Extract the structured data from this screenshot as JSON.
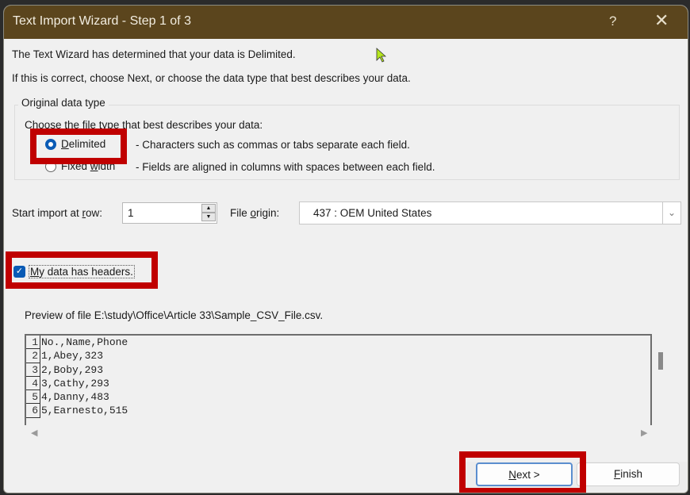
{
  "dialog": {
    "title": "Text Import Wizard - Step 1 of 3",
    "help_label": "?",
    "close_label": "✕"
  },
  "intro": {
    "line1": "The Text Wizard has determined that your data is Delimited.",
    "line2": "If this is correct, choose Next, or choose the data type that best describes your data."
  },
  "data_type": {
    "group_label": "Original data type",
    "prompt": "Choose the file type that best describes your data:",
    "options": [
      {
        "label_pre": "",
        "label_underline": "D",
        "label_post": "elimited",
        "description": "- Characters such as commas or tabs separate each field.",
        "selected": true
      },
      {
        "label_pre": "Fixed ",
        "label_underline": "w",
        "label_post": "idth",
        "description": "- Fields are aligned in columns with spaces between each field.",
        "selected": false
      }
    ]
  },
  "start_row": {
    "label_pre": "Start import at ",
    "label_underline": "r",
    "label_post": "ow:",
    "value": "1"
  },
  "file_origin": {
    "label_pre": "File ",
    "label_underline": "o",
    "label_post": "rigin:",
    "value": "437 : OEM United States",
    "chevron": "⌄"
  },
  "headers_checkbox": {
    "checked": true,
    "label_underline": "M",
    "label_post": "y data has headers."
  },
  "preview": {
    "label": "Preview of file E:\\study\\Office\\Article 33\\Sample_CSV_File.csv.",
    "rows": [
      {
        "num": "1",
        "text": "No.,Name,Phone"
      },
      {
        "num": "2",
        "text": "1,Abey,323"
      },
      {
        "num": "3",
        "text": "2,Boby,293"
      },
      {
        "num": "4",
        "text": "3,Cathy,293"
      },
      {
        "num": "5",
        "text": "4,Danny,483"
      },
      {
        "num": "6",
        "text": "5,Earnesto,515"
      }
    ]
  },
  "buttons": {
    "next_underline": "N",
    "next_post": "ext >",
    "finish_underline": "F",
    "finish_post": "inish"
  },
  "colors": {
    "titlebar": "#5b451d",
    "highlight": "#c00000",
    "accent": "#0a5bb5"
  }
}
